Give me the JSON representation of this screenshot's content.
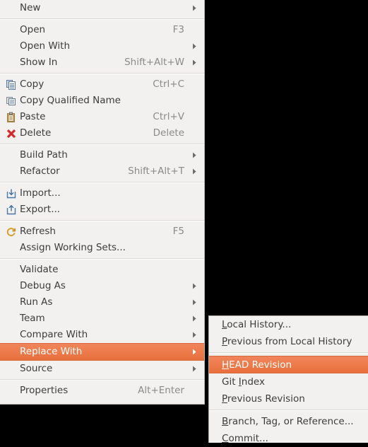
{
  "colors": {
    "menu_background": "#f2f1f0",
    "text": "#3c3c3c",
    "accelerator_text": "#8a8a8a",
    "highlight_start": "#f0855a",
    "highlight_end": "#e8703c",
    "highlight_text": "#ffffff",
    "separator": "#dcd9d6",
    "border": "#b6b2ae",
    "desktop": "#000000"
  },
  "context_menu": {
    "name": "eclipse-project-context-menu",
    "groups": [
      {
        "items": [
          {
            "label": "New",
            "accel": "",
            "icon": "",
            "submenu": true,
            "selected": false
          }
        ]
      },
      {
        "items": [
          {
            "label": "Open",
            "accel": "F3",
            "icon": "",
            "submenu": false,
            "selected": false
          },
          {
            "label": "Open With",
            "accel": "",
            "icon": "",
            "submenu": true,
            "selected": false
          },
          {
            "label": "Show In",
            "accel": "Shift+Alt+W",
            "icon": "",
            "submenu": true,
            "selected": false
          }
        ]
      },
      {
        "items": [
          {
            "label": "Copy",
            "accel": "Ctrl+C",
            "icon": "copy-icon",
            "submenu": false,
            "selected": false
          },
          {
            "label": "Copy Qualified Name",
            "accel": "",
            "icon": "copy-qualified-name-icon",
            "submenu": false,
            "selected": false
          },
          {
            "label": "Paste",
            "accel": "Ctrl+V",
            "icon": "paste-icon",
            "submenu": false,
            "selected": false
          },
          {
            "label": "Delete",
            "accel": "Delete",
            "icon": "delete-icon",
            "submenu": false,
            "selected": false
          }
        ]
      },
      {
        "items": [
          {
            "label": "Build Path",
            "accel": "",
            "icon": "",
            "submenu": true,
            "selected": false
          },
          {
            "label": "Refactor",
            "accel": "Shift+Alt+T",
            "icon": "",
            "submenu": true,
            "selected": false
          }
        ]
      },
      {
        "items": [
          {
            "label": "Import...",
            "accel": "",
            "icon": "import-icon",
            "submenu": false,
            "selected": false
          },
          {
            "label": "Export...",
            "accel": "",
            "icon": "export-icon",
            "submenu": false,
            "selected": false
          }
        ]
      },
      {
        "items": [
          {
            "label": "Refresh",
            "accel": "F5",
            "icon": "refresh-icon",
            "submenu": false,
            "selected": false
          },
          {
            "label": "Assign Working Sets...",
            "accel": "",
            "icon": "",
            "submenu": false,
            "selected": false
          }
        ]
      },
      {
        "items": [
          {
            "label": "Validate",
            "accel": "",
            "icon": "",
            "submenu": false,
            "selected": false
          },
          {
            "label": "Debug As",
            "accel": "",
            "icon": "",
            "submenu": true,
            "selected": false
          },
          {
            "label": "Run As",
            "accel": "",
            "icon": "",
            "submenu": true,
            "selected": false
          },
          {
            "label": "Team",
            "accel": "",
            "icon": "",
            "submenu": true,
            "selected": false
          },
          {
            "label": "Compare With",
            "accel": "",
            "icon": "",
            "submenu": true,
            "selected": false
          },
          {
            "label": "Replace With",
            "accel": "",
            "icon": "",
            "submenu": true,
            "selected": true
          },
          {
            "label": "Source",
            "accel": "",
            "icon": "",
            "submenu": true,
            "selected": false
          }
        ]
      },
      {
        "items": [
          {
            "label": "Properties",
            "accel": "Alt+Enter",
            "icon": "",
            "submenu": false,
            "selected": false
          }
        ]
      }
    ]
  },
  "submenu": {
    "name": "replace-with-submenu",
    "parent": "Replace With",
    "groups": [
      {
        "items": [
          {
            "mnemonic": "L",
            "rest": "ocal History...",
            "selected": false
          },
          {
            "mnemonic": "P",
            "rest": "revious from Local History",
            "selected": false
          }
        ]
      },
      {
        "items": [
          {
            "mnemonic": "H",
            "rest": "EAD Revision",
            "selected": true
          },
          {
            "mnemonic": "I",
            "rest": "ndex",
            "prefix": "Git ",
            "selected": false
          },
          {
            "mnemonic": "P",
            "rest": "revious Revision",
            "selected": false
          }
        ]
      },
      {
        "items": [
          {
            "mnemonic": "B",
            "rest": "ranch, Tag, or Reference...",
            "selected": false
          },
          {
            "mnemonic": "C",
            "rest": "ommit...",
            "selected": false
          }
        ]
      }
    ]
  }
}
